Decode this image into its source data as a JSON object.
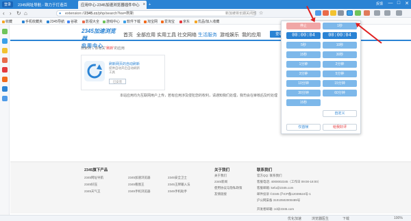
{
  "browser": {
    "logo_label": "登录",
    "tabs": [
      {
        "title": "2345网址导航 - 致力于打造百"
      },
      {
        "title": "应用中心-2345加速浏览器插件中心"
      }
    ],
    "new_tab": "+",
    "window_controls": {
      "user": "反馈",
      "minimize": "—",
      "maximize": "□",
      "close": "✕"
    }
  },
  "navbar": {
    "back": "‹",
    "forward": "›",
    "refresh": "↻",
    "home": "⌂",
    "url_prefix": "extension",
    "url_host": "2345.cc",
    "url_path": "/php/search?kw=刷新",
    "search_placeholder": "新加坡将长期关闭部分主题乐园",
    "favorite": "☆"
  },
  "bookmarks": [
    {
      "label": "收藏"
    },
    {
      "label": "手机收藏夹"
    },
    {
      "label": "2345导航"
    },
    {
      "label": "谷歌"
    },
    {
      "label": "影视大全"
    },
    {
      "label": "游戏中心"
    },
    {
      "label": "软件下载"
    },
    {
      "label": "淘宝网"
    },
    {
      "label": "爱淘宝"
    },
    {
      "label": "京东"
    },
    {
      "label": "优品/加入收藏"
    }
  ],
  "site": {
    "logo_line1": "2345加速浏览器",
    "logo_line2": "应用中心",
    "nav": [
      "首页",
      "全部应用",
      "实用工具",
      "社交网络",
      "生活服务",
      "游戏娱乐",
      "我的应用"
    ],
    "register_button": "登录/注册",
    "result_prefix": "搜索到 1 条有关",
    "result_keyword": "“刷新”",
    "result_suffix": "的应用",
    "app": {
      "name": "刷新网页的自动刷新",
      "desc": "提供自动开启自动刷新工具",
      "install_button": "已安装"
    },
    "notice": "本站应用均为互联网用户上传，若有应用涉及侵犯您的权利，请通知我们处理，我司会在审核后及时处理"
  },
  "footer": {
    "products_title": "2345旗下产品",
    "products": [
      "2345网址导航",
      "2345加速浏览器",
      "2345安全卫士",
      "2345好压",
      "2345看图王",
      "2345王牌输入法",
      "2345天气王",
      "2345手机浏览器",
      "2345手机助手"
    ],
    "about_title": "关于我们",
    "about": [
      "关于我们",
      "2345新闻",
      "使用协议与隐私政策",
      "友情链接"
    ],
    "contact_title": "联系我们",
    "contact": [
      "官方QQ: 联系我们",
      "客服电话: 4000002345（工作日 09:00-18:00）",
      "客服邮箱: kefu@2345.com",
      "邮件投诉 ©2345 沪ICP备12039524号-1",
      "沪公网安备 31010502000489号"
    ],
    "bottom": "开发者邮箱: zd@2345.com"
  },
  "popup": {
    "buttons": [
      {
        "label": "停止",
        "style": "danger"
      },
      {
        "label": "1秒",
        "style": "normal"
      },
      {
        "label": "00:00:04",
        "style": "timer"
      },
      {
        "label": "5秒",
        "style": "normal"
      },
      {
        "label": "10秒",
        "style": "normal"
      },
      {
        "label": "15秒",
        "style": "normal"
      },
      {
        "label": "30秒",
        "style": "normal"
      },
      {
        "label": "1分钟",
        "style": "normal"
      },
      {
        "label": "2分钟",
        "style": "normal"
      },
      {
        "label": "3分钟",
        "style": "normal"
      },
      {
        "label": "5分钟",
        "style": "normal"
      },
      {
        "label": "10分钟",
        "style": "normal"
      },
      {
        "label": "15分钟",
        "style": "normal"
      },
      {
        "label": "30分钟",
        "style": "normal"
      },
      {
        "label": "60分钟",
        "style": "normal"
      },
      {
        "label": "自定义",
        "style": "ghost"
      },
      {
        "label": "仅首帧",
        "style": "ghost"
      },
      {
        "label": "给我好评",
        "style": "ghostred"
      }
    ]
  },
  "statusbar": {
    "left": "",
    "items": [
      "优化加速",
      "浏览器医生",
      "下载",
      "100%"
    ]
  }
}
